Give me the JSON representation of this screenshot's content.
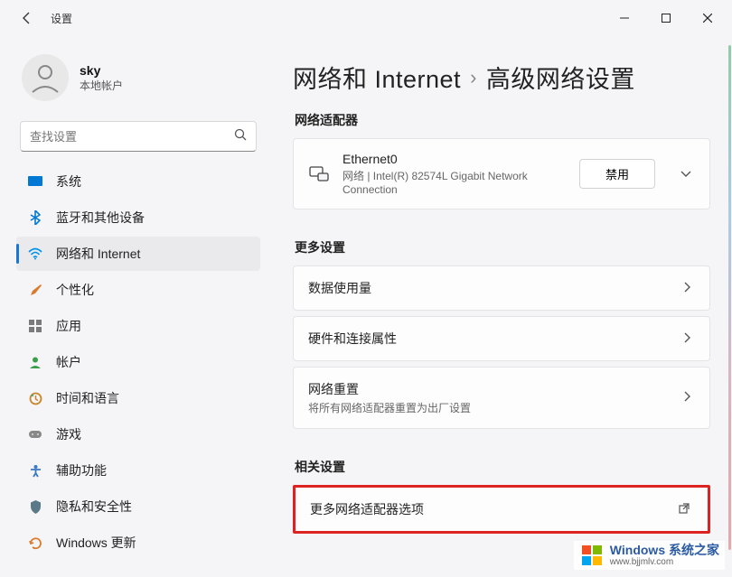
{
  "window": {
    "title": "设置",
    "controls": {
      "minimize": "minimize",
      "maximize": "maximize",
      "close": "close"
    }
  },
  "user": {
    "name": "sky",
    "account_type": "本地帐户"
  },
  "search": {
    "placeholder": "查找设置"
  },
  "nav": {
    "items": [
      {
        "id": "system",
        "icon": "💻",
        "color": "#0078d4",
        "label": "系统"
      },
      {
        "id": "bluetooth",
        "icon": "bt",
        "color": "#0078d4",
        "label": "蓝牙和其他设备"
      },
      {
        "id": "network",
        "icon": "wifi",
        "color": "#0091ea",
        "label": "网络和 Internet",
        "active": true
      },
      {
        "id": "personalization",
        "icon": "🖌",
        "color": "#d97b2e",
        "label": "个性化"
      },
      {
        "id": "apps",
        "icon": "▦",
        "color": "#7a7a7a",
        "label": "应用"
      },
      {
        "id": "accounts",
        "icon": "👤",
        "color": "#3a9e48",
        "label": "帐户"
      },
      {
        "id": "time",
        "icon": "🕒",
        "color": "#c8852a",
        "label": "时间和语言"
      },
      {
        "id": "gaming",
        "icon": "🎮",
        "color": "#7a7a7a",
        "label": "游戏"
      },
      {
        "id": "accessibility",
        "icon": "✳",
        "color": "#3b78c4",
        "label": "辅助功能"
      },
      {
        "id": "privacy",
        "icon": "🛡",
        "color": "#5a7a8a",
        "label": "隐私和安全性"
      },
      {
        "id": "update",
        "icon": "🔄",
        "color": "#d97b2e",
        "label": "Windows 更新"
      }
    ]
  },
  "breadcrumb": {
    "part1": "网络和 Internet",
    "part2": "高级网络设置"
  },
  "sections": {
    "adapters_label": "网络适配器",
    "adapter": {
      "name": "Ethernet0",
      "desc": "网络 | Intel(R) 82574L Gigabit Network Connection",
      "disable_label": "禁用"
    },
    "more_label": "更多设置",
    "data_usage": "数据使用量",
    "hw_props": "硬件和连接属性",
    "reset_title": "网络重置",
    "reset_desc": "将所有网络适配器重置为出厂设置",
    "related_label": "相关设置",
    "more_adapter_options": "更多网络适配器选项"
  },
  "watermark": {
    "main": "Windows 系统之家",
    "sub": "www.bjjmlv.com"
  }
}
